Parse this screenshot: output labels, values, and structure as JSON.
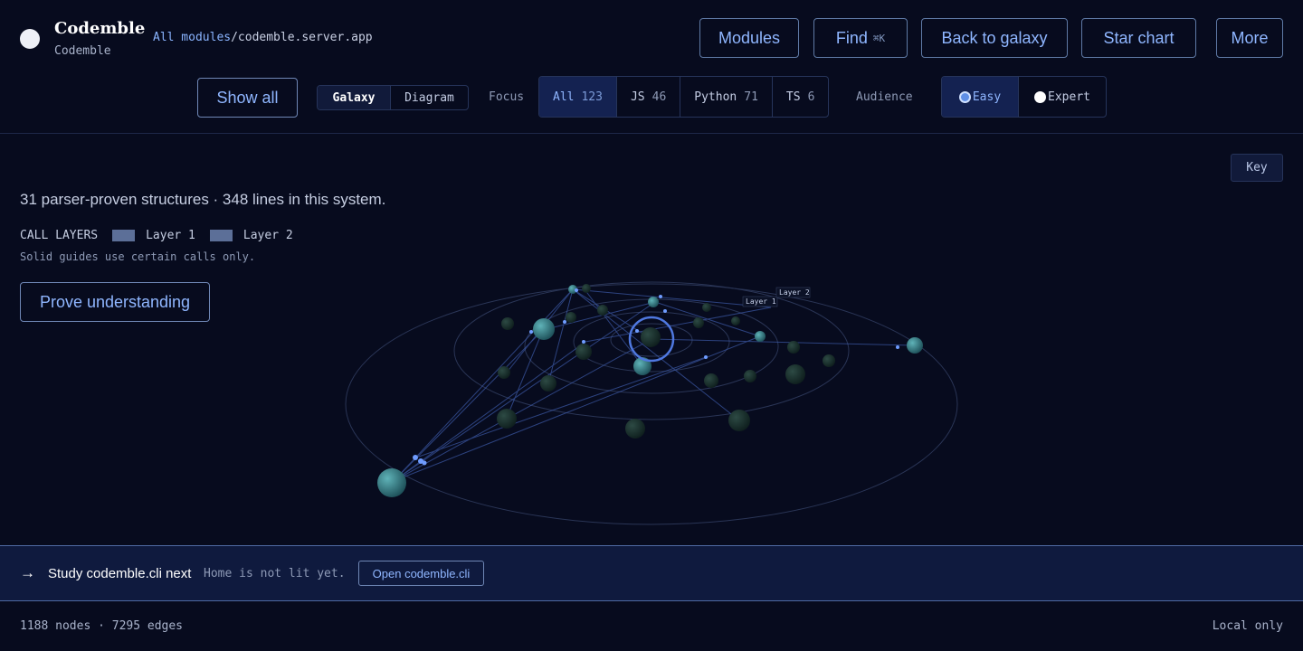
{
  "header": {
    "brand_title": "Codemble",
    "brand_subtitle": "Codemble",
    "breadcrumb_link": "All modules",
    "breadcrumb_rest": "/codemble.server.app",
    "buttons": {
      "modules": "Modules",
      "find": "Find",
      "find_shortcut": "⌘K",
      "back": "Back to galaxy",
      "star_chart": "Star chart",
      "more": "More"
    }
  },
  "toolbar": {
    "show_all": "Show all",
    "view_options": [
      "Galaxy",
      "Diagram"
    ],
    "view_selected": "Galaxy",
    "focus_label": "Focus",
    "focus_options": [
      {
        "label": "All",
        "count": "123"
      },
      {
        "label": "JS",
        "count": "46"
      },
      {
        "label": "Python",
        "count": "71"
      },
      {
        "label": "TS",
        "count": "6"
      }
    ],
    "focus_selected": "All",
    "audience_label": "Audience",
    "audience_options": [
      "Easy",
      "Expert"
    ],
    "audience_selected": "Easy"
  },
  "main": {
    "key_button": "Key",
    "summary": "31 parser-proven structures · 348 lines in this system.",
    "call_layers_label": "CALL LAYERS",
    "layers": [
      "Layer 1",
      "Layer 2"
    ],
    "layer_color": "#5c6f98",
    "note": "Solid guides use certain calls only.",
    "prove_button": "Prove understanding",
    "galaxy_labels": [
      "Layer 1",
      "Layer 2"
    ]
  },
  "next_bar": {
    "arrow": "→",
    "title": "Study codemble.cli next",
    "note": "Home is not lit yet.",
    "button": "Open codemble.cli"
  },
  "footer": {
    "stats": "1188 nodes · 7295 edges",
    "mode": "Local only"
  },
  "colors": {
    "background": "#070b1e",
    "accent": "#8fb6ff",
    "selection": "#142251"
  }
}
